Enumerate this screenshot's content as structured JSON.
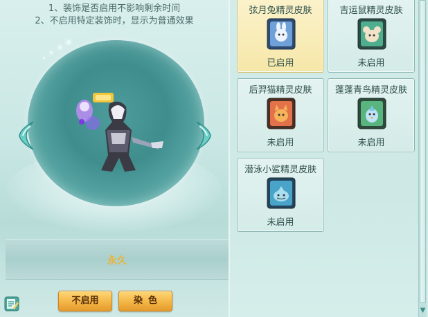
{
  "notes": [
    "1、装饰是否启用不影响剩余时间",
    "2、不启用特定装饰时，显示为普通效果"
  ],
  "duration": "永久",
  "buttons": {
    "disable": "不启用",
    "dye": "染色"
  },
  "skins": [
    {
      "name": "弦月兔精灵皮肤",
      "status": "已启用",
      "active": true,
      "icon": "rabbit-card-icon",
      "color": "#6fa0d8"
    },
    {
      "name": "吉运鼠精灵皮肤",
      "status": "未启用",
      "active": false,
      "icon": "mouse-card-icon",
      "color": "#4fae8d"
    },
    {
      "name": "后羿猫精灵皮肤",
      "status": "未启用",
      "active": false,
      "icon": "cat-card-icon",
      "color": "#e3714a"
    },
    {
      "name": "蓬蓬青鸟精灵皮肤",
      "status": "未启用",
      "active": false,
      "icon": "bluebird-card-icon",
      "color": "#58b57d"
    },
    {
      "name": "潜泳小鲨精灵皮肤",
      "status": "未启用",
      "active": false,
      "icon": "shark-card-icon",
      "color": "#4aa3c8"
    }
  ],
  "colors": {
    "accent_gold": "#e9b43a",
    "button_orange": "#f3b646",
    "panel_teal": "#cde8e5"
  }
}
